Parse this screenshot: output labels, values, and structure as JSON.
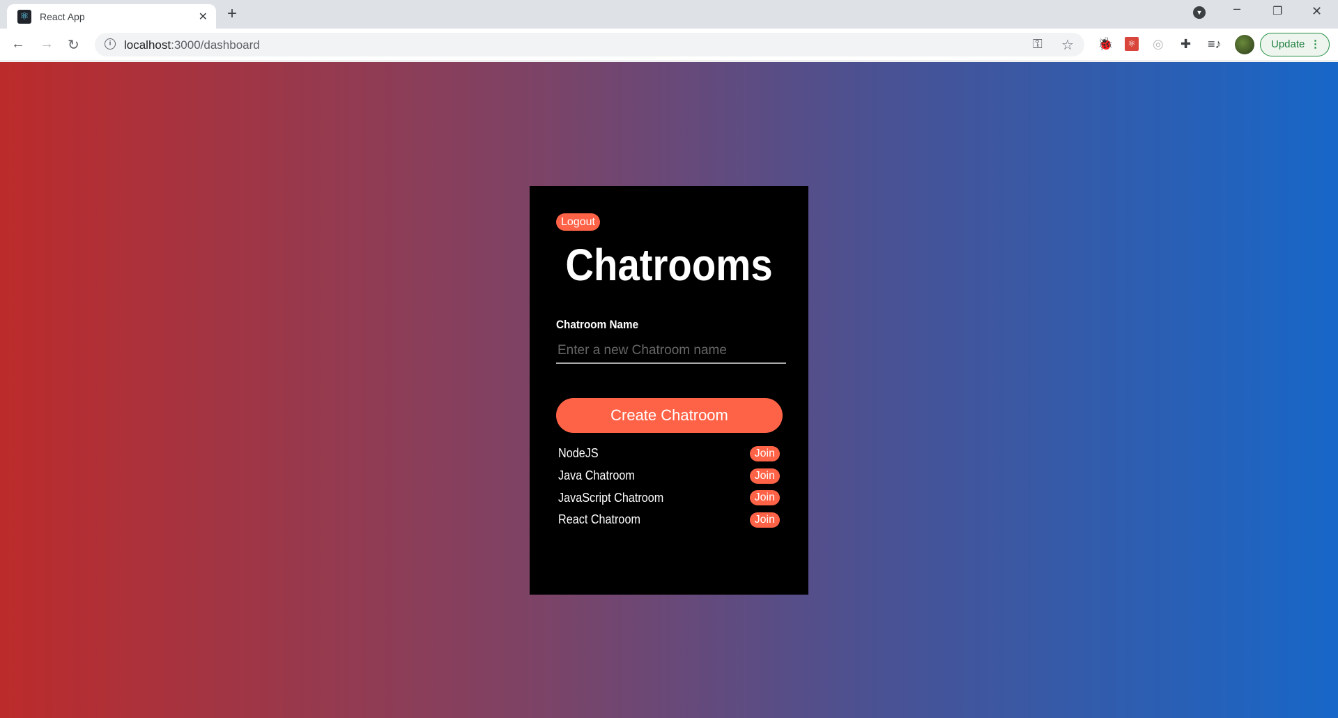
{
  "browser": {
    "tab_title": "React App",
    "url_host": "localhost",
    "url_path": ":3000/dashboard",
    "update_label": "Update"
  },
  "dashboard": {
    "logout_label": "Logout",
    "title": "Chatrooms",
    "field_label": "Chatroom Name",
    "field_placeholder": "Enter a new Chatroom name",
    "field_value": "",
    "create_label": "Create Chatroom",
    "join_label": "Join",
    "rooms": [
      "NodeJS",
      "Java Chatroom",
      "JavaScript Chatroom",
      "React Chatroom"
    ]
  },
  "colors": {
    "accent": "#ff6347",
    "gradient_start": "#bc2b2b",
    "gradient_end": "#1767c8"
  }
}
